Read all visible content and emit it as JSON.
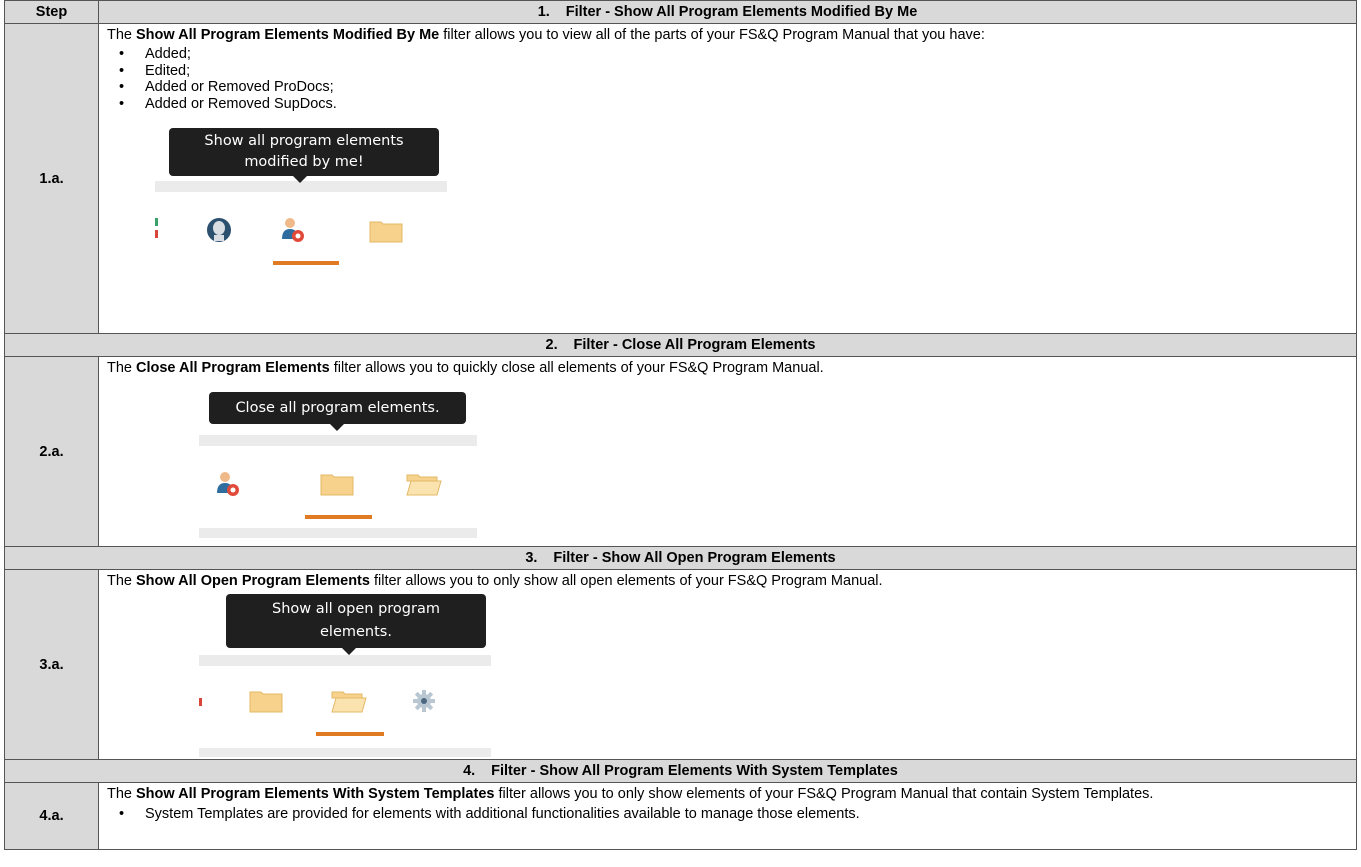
{
  "header": {
    "step": "Step",
    "section_num": "1.",
    "section_title": "Filter - Show All Program Elements Modified By Me"
  },
  "s1": {
    "step": "1.a.",
    "intro_pre": "The ",
    "intro_bold": "Show All Program Elements Modified By Me",
    "intro_post": " filter allows you to view all of the parts of your FS&Q Program Manual that you have:",
    "bullets": [
      "Added;",
      "Edited;",
      "Added or Removed ProDocs;",
      "Added or Removed SupDocs."
    ],
    "tooltip_line1": "Show all program elements",
    "tooltip_line2": "modified by me!"
  },
  "sec2": {
    "num": "2.",
    "title": "Filter - Close All Program Elements"
  },
  "s2": {
    "step": "2.a.",
    "intro_pre": "The ",
    "intro_bold": "Close All Program Elements",
    "intro_post": " filter allows you to quickly close all elements of your FS&Q Program Manual.",
    "tooltip": "Close all program elements."
  },
  "sec3": {
    "num": "3.",
    "title": "Filter - Show All Open Program Elements"
  },
  "s3": {
    "step": "3.a.",
    "intro_pre": "The ",
    "intro_bold": "Show All Open Program Elements",
    "intro_post": " filter allows you to only show all open elements of your FS&Q Program Manual.",
    "tooltip_line1": "Show all open program",
    "tooltip_line2": "elements."
  },
  "sec4": {
    "num": "4.",
    "title": "Filter - Show All Program Elements With System Templates"
  },
  "s4": {
    "step": "4.a.",
    "intro_pre": "The ",
    "intro_bold": "Show All Program Elements With System Templates",
    "intro_post": " filter allows you to only show elements of your FS&Q Program Manual that contain System Templates.",
    "bullet": "System Templates are provided for elements with additional functionalities available to manage those elements."
  },
  "colors": {
    "header_grey": "#d9d9d9",
    "tooltip_bg": "#1f1f1f",
    "active_underline": "#e07b24",
    "folder": "#f6d28c",
    "user_blue": "#2f6d9f"
  }
}
